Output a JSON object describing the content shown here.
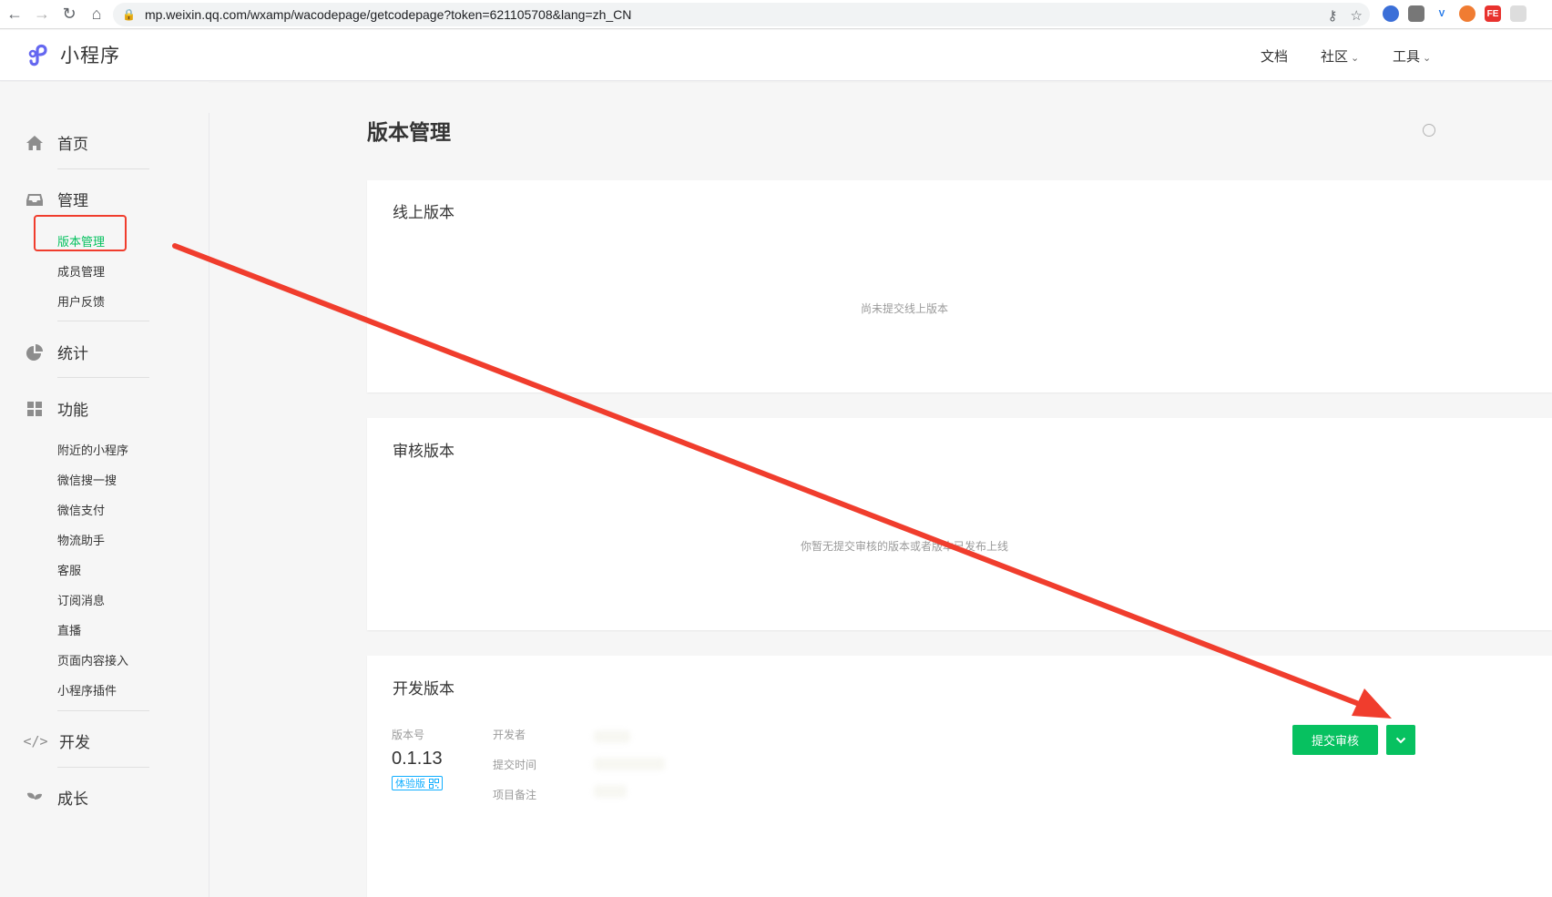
{
  "browser": {
    "url": "mp.weixin.qq.com/wxamp/wacodepage/getcodepage?token=621105708&lang=zh_CN"
  },
  "header": {
    "logo_text": "小程序",
    "nav": {
      "docs": "文档",
      "community": "社区",
      "tools": "工具"
    }
  },
  "sidebar": {
    "home": "首页",
    "manage": "管理",
    "manage_items": [
      "版本管理",
      "成员管理",
      "用户反馈"
    ],
    "stats": "统计",
    "features": "功能",
    "feature_items": [
      "附近的小程序",
      "微信搜一搜",
      "微信支付",
      "物流助手",
      "客服",
      "订阅消息",
      "直播",
      "页面内容接入",
      "小程序插件"
    ],
    "develop": "开发",
    "growth": "成长"
  },
  "main": {
    "title": "版本管理",
    "online": {
      "title": "线上版本",
      "empty": "尚未提交线上版本"
    },
    "review": {
      "title": "审核版本",
      "empty": "你暂无提交审核的版本或者版本已发布上线"
    },
    "dev": {
      "title": "开发版本",
      "version_label": "版本号",
      "version": "0.1.13",
      "badge": "体验版",
      "developer_label": "开发者",
      "submit_time_label": "提交时间",
      "note_label": "项目备注",
      "submit_button": "提交审核"
    }
  },
  "colors": {
    "accent": "#07c160",
    "annotation": "#f03d2d",
    "badge": "#10aeff"
  }
}
